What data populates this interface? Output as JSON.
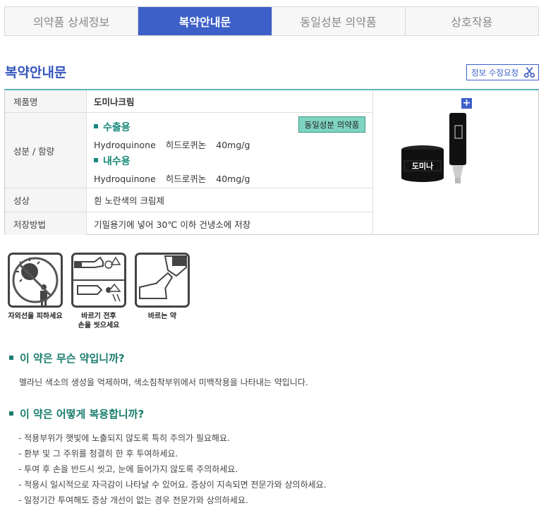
{
  "tabs": [
    {
      "label": "의약품 상세정보"
    },
    {
      "label": "복약안내문"
    },
    {
      "label": "동일성분 의약품"
    },
    {
      "label": "상호작용"
    }
  ],
  "section_title": "복약안내문",
  "edit_button": "정보 수정요청",
  "info": {
    "name_label": "제품명",
    "name_value": "도미나크림",
    "ingredient_label": "성분 / 함량",
    "external_use_heading": "수출용",
    "external_ingredient": {
      "name": "Hydroquinone",
      "korean": "히드로퀴논",
      "amount": "40mg/g"
    },
    "internal_use_heading": "내수용",
    "internal_ingredient": {
      "name": "Hydroquinone",
      "korean": "히드로퀴논",
      "amount": "40mg/g"
    },
    "same_ingredient_button": "동일성분 의약품",
    "appearance_label": "성상",
    "appearance_value": "흰 노란색의 크림제",
    "storage_label": "저장방법",
    "storage_value": "기밀용기에 넣어 30℃ 이하 건냉소에 저장",
    "plus_button": "+",
    "product_brand": "도미나"
  },
  "pictograms": [
    {
      "label": "자외선을 피하세요",
      "icon": "avoid-sunlight-icon"
    },
    {
      "label": "바르기 전후\n손을 씻으세요",
      "icon": "wash-hands-icon"
    },
    {
      "label": "바르는 약",
      "icon": "topical-medicine-icon"
    }
  ],
  "q1": {
    "heading": "이 약은 무슨 약입니까?",
    "answer": "멜라닌 색소의 생성을 억제하며, 색소침착부위에서 미백작용을 나타내는 약입니다."
  },
  "q2": {
    "heading": "이 약은 어떻게 복용합니까?",
    "items": [
      "- 적용부위가 햇빛에 노출되지 않도록 특히 주의가 필요해요.",
      "- 환부 및 그 주위를 청결히 한 후 투여하세요.",
      "- 투여 후 손을 반드시 씻고, 눈에 들어가지 않도록 주의하세요.",
      "- 적용시 일시적으로 자극감이 나타날 수 있어요. 증상이 지속되면 전문가와 상의하세요.",
      "- 일정기간 투여해도 증상 개선이 없는 경우 전문가와 상의하세요."
    ]
  },
  "colors": {
    "accent": "#3d5fc8",
    "teal": "#1a7c6e"
  }
}
